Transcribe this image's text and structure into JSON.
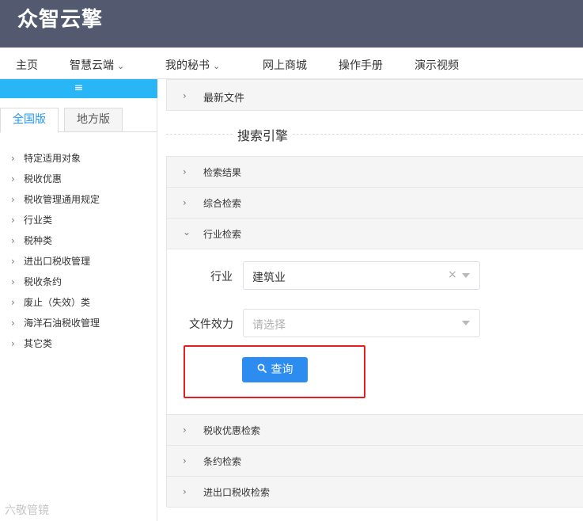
{
  "app": {
    "logo": "众智云擎"
  },
  "topnav": {
    "items": [
      {
        "label": "主页"
      },
      {
        "label": "智慧云端",
        "dropdown": true
      },
      {
        "label": "我的秘书",
        "dropdown": true
      },
      {
        "label": "网上商城"
      },
      {
        "label": "操作手册"
      },
      {
        "label": "演示视频"
      }
    ]
  },
  "sidebar": {
    "toggle_icon": "menu-icon",
    "toggle_glyph": "≡",
    "tabs": [
      {
        "label": "全国版",
        "active": true
      },
      {
        "label": "地方版",
        "active": false
      }
    ],
    "items": [
      {
        "label": "特定适用对象"
      },
      {
        "label": "税收优惠"
      },
      {
        "label": "税收管理通用规定"
      },
      {
        "label": "行业类"
      },
      {
        "label": "税种类"
      },
      {
        "label": "进出口税收管理"
      },
      {
        "label": "税收条约"
      },
      {
        "label": "废止（失效）类"
      },
      {
        "label": "海洋石油税收管理"
      },
      {
        "label": "其它类"
      }
    ]
  },
  "main": {
    "latest_files": "最新文件",
    "search_title": "搜索引擎",
    "panels": {
      "results": "检索结果",
      "comprehensive": "综合检索",
      "industry": "行业检索",
      "tax_incentive": "税收优惠检索",
      "treaty": "条约检索",
      "import_export": "进出口税收检索"
    },
    "industry_form": {
      "industry_label": "行业",
      "industry_value": "建筑业",
      "effect_label": "文件效力",
      "effect_placeholder": "请选择",
      "query_button": "查询"
    }
  },
  "watermark": "六敬管镜",
  "colors": {
    "header_bg": "#535a70",
    "accent": "#29b6f6",
    "button": "#2d8cf0",
    "highlight": "#e02020"
  }
}
